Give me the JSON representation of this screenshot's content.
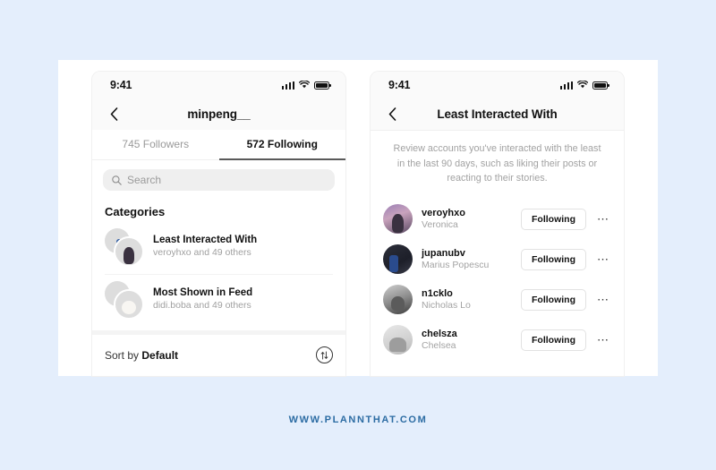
{
  "watermark": "WWW.PLANNTHAT.COM",
  "colors": {
    "page_background": "#e4eefc",
    "watermark": "#2c6ca3",
    "card": "#ffffff",
    "muted_text": "#a0a0a0",
    "primary_text": "#111111",
    "search_field": "#efefef"
  },
  "left_phone": {
    "status": {
      "time": "9:41",
      "signal_icon": "signal-bars-icon",
      "wifi_icon": "wifi-icon",
      "battery_icon": "battery-icon"
    },
    "nav": {
      "back_icon": "chevron-left-icon",
      "title": "minpeng__"
    },
    "tabs": [
      {
        "label": "745 Followers",
        "active": false
      },
      {
        "label": "572 Following",
        "active": true
      }
    ],
    "search": {
      "icon": "search-icon",
      "placeholder": "Search",
      "value": ""
    },
    "section_title": "Categories",
    "categories": [
      {
        "name": "Least Interacted With",
        "subtitle": "veroyhxo and 49 others"
      },
      {
        "name": "Most Shown in Feed",
        "subtitle": "didi.boba and 49 others"
      }
    ],
    "sort": {
      "prefix": "Sort by ",
      "value": "Default",
      "icon": "sort-arrows-icon"
    }
  },
  "right_phone": {
    "status": {
      "time": "9:41",
      "signal_icon": "signal-bars-icon",
      "wifi_icon": "wifi-icon",
      "battery_icon": "battery-icon"
    },
    "nav": {
      "back_icon": "chevron-left-icon",
      "title": "Least Interacted With"
    },
    "description": "Review accounts you've interacted with the least in the last 90 days, such as liking their posts or reacting to their stories.",
    "users": [
      {
        "username": "veroyhxo",
        "fullname": "Veronica",
        "action": "Following",
        "menu_icon": "more-options-icon"
      },
      {
        "username": "jupanubv",
        "fullname": "Marius Popescu",
        "action": "Following",
        "menu_icon": "more-options-icon"
      },
      {
        "username": "n1cklo",
        "fullname": "Nicholas Lo",
        "action": "Following",
        "menu_icon": "more-options-icon"
      },
      {
        "username": "chelsza",
        "fullname": "Chelsea",
        "action": "Following",
        "menu_icon": "more-options-icon"
      }
    ]
  }
}
